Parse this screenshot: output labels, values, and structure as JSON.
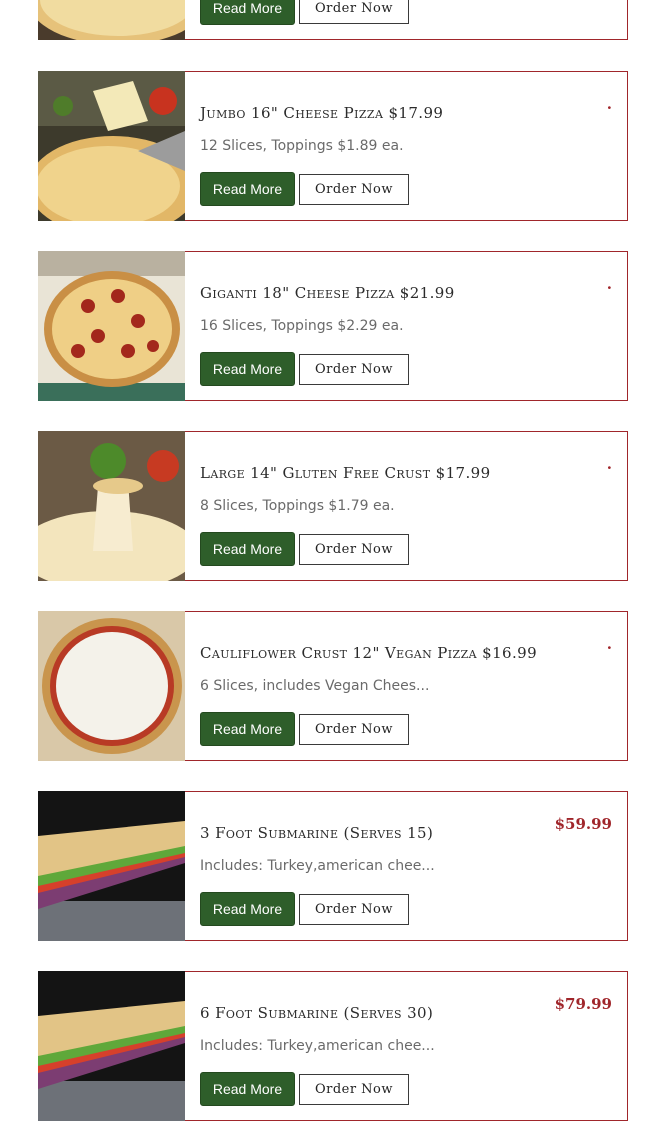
{
  "theme": {
    "accent": "#a0262b",
    "button_green": "#2e5e2a"
  },
  "items": [
    {
      "title": "",
      "description": "",
      "price": "",
      "image": "pizza-photo",
      "read_more": "Read More",
      "order_now": "Order Now"
    },
    {
      "title": "Jumbo 16\" Cheese Pizza $17.99",
      "description": "12 Slices, Toppings $1.89 ea.",
      "price": ".",
      "image": "cheese-pizza-photo",
      "read_more": "Read More",
      "order_now": "Order Now"
    },
    {
      "title": "Giganti 18\" Cheese Pizza $21.99",
      "description": "16 Slices, Toppings $2.29 ea.",
      "price": ".",
      "image": "pepperoni-pizza-photo",
      "read_more": "Read More",
      "order_now": "Order Now"
    },
    {
      "title": "Large 14\" Gluten Free Crust $17.99",
      "description": "8 Slices, Toppings $1.79 ea.",
      "price": ".",
      "image": "cheese-pull-pizza-photo",
      "read_more": "Read More",
      "order_now": "Order Now"
    },
    {
      "title": "Cauliflower Crust 12\" Vegan Pizza $16.99",
      "description": "6 Slices, includes Vegan Chees...",
      "price": ".",
      "image": "cauliflower-pizza-photo",
      "read_more": "Read More",
      "order_now": "Order Now"
    },
    {
      "title": "3 Foot Submarine (Serves 15)",
      "description": "Includes: Turkey,american chee...",
      "price": "$59.99",
      "image": "submarine-sandwich-photo",
      "read_more": "Read More",
      "order_now": "Order Now"
    },
    {
      "title": "6 Foot Submarine (Serves 30)",
      "description": "Includes: Turkey,american chee...",
      "price": "$79.99",
      "image": "submarine-sandwich-photo",
      "read_more": "Read More",
      "order_now": "Order Now"
    }
  ]
}
